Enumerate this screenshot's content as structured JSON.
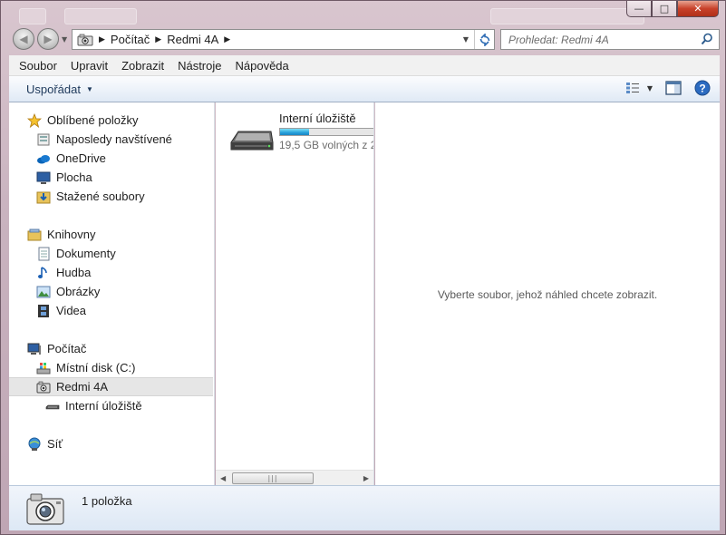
{
  "window": {
    "controls": {
      "minimize": "—",
      "maximize": "□",
      "close": "✕"
    }
  },
  "address": {
    "crumbs": [
      "Počítač",
      "Redmi 4A"
    ],
    "icon": "device-camera-icon"
  },
  "search": {
    "placeholder": "Prohledat: Redmi 4A"
  },
  "menu": [
    "Soubor",
    "Upravit",
    "Zobrazit",
    "Nástroje",
    "Nápověda"
  ],
  "toolbar": {
    "organize_label": "Uspořádat"
  },
  "sidebar": {
    "items": [
      {
        "label": "Oblíbené položky",
        "icon": "star-icon"
      },
      {
        "label": "Naposledy navštívené",
        "icon": "recent-places-icon"
      },
      {
        "label": "OneDrive",
        "icon": "onedrive-cloud-icon"
      },
      {
        "label": "Plocha",
        "icon": "desktop-icon"
      },
      {
        "label": "Stažené soubory",
        "icon": "downloads-folder-icon"
      },
      {
        "label": "Knihovny",
        "icon": "libraries-icon"
      },
      {
        "label": "Dokumenty",
        "icon": "documents-icon"
      },
      {
        "label": "Hudba",
        "icon": "music-note-icon"
      },
      {
        "label": "Obrázky",
        "icon": "pictures-icon"
      },
      {
        "label": "Videa",
        "icon": "film-strip-icon"
      },
      {
        "label": "Počítač",
        "icon": "computer-icon"
      },
      {
        "label": "Místní disk (C:)",
        "icon": "local-disk-icon"
      },
      {
        "label": "Redmi 4A",
        "icon": "device-camera-icon"
      },
      {
        "label": "Interní úložiště",
        "icon": "storage-drive-icon"
      },
      {
        "label": "Síť",
        "icon": "network-icon"
      }
    ]
  },
  "content": {
    "drive": {
      "name": "Interní úložiště",
      "free_text": "19,5 GB volných z 2",
      "used_fraction": 0.3
    },
    "preview_message": "Vyberte soubor, jehož náhled chcete zobrazit."
  },
  "status": {
    "count_text": "1 položka"
  },
  "colors": {
    "accent": "#26a0da",
    "frame": "#c9b3bf",
    "command_bar": "#dfe9f5"
  }
}
